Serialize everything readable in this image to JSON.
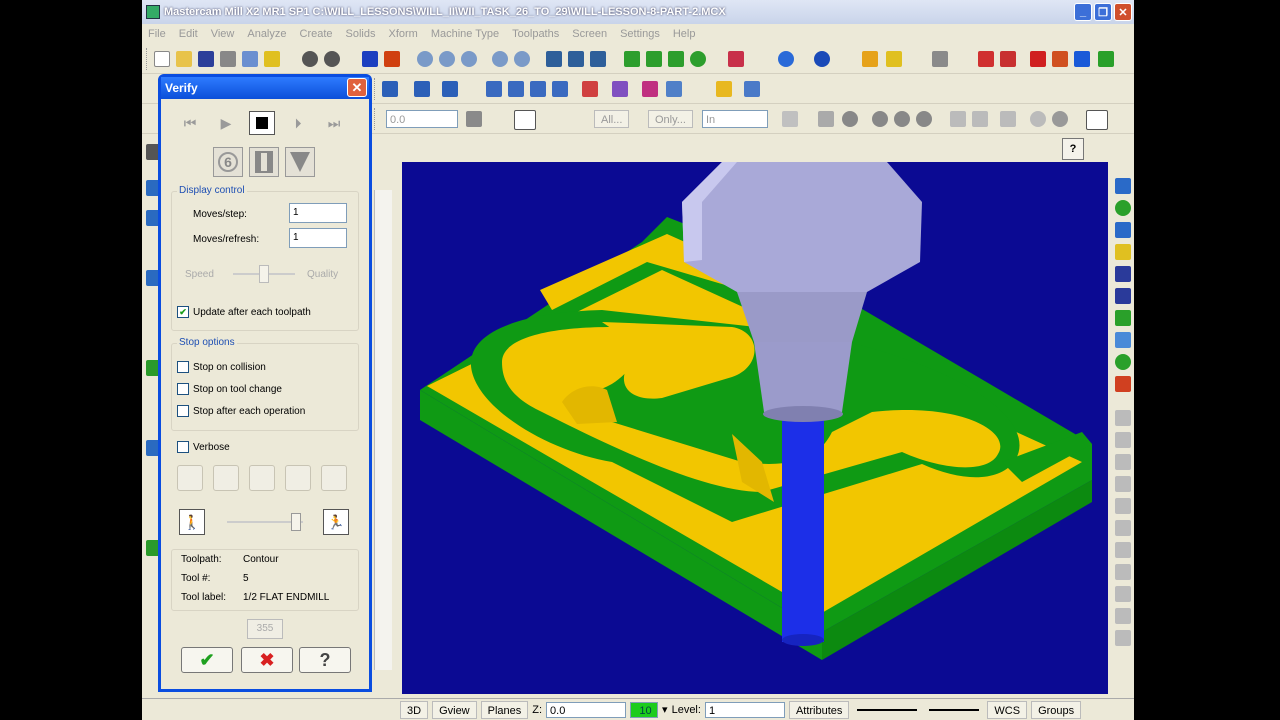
{
  "window": {
    "title": "Mastercam Mill X2 MR1 SP1  C:\\WILL_LESSONS\\WILL_II\\WII_TASK_26_TO_29\\WILL-LESSON-8-PART-2.MCX",
    "min_label": "_",
    "max_label": "❐",
    "close_label": "✕"
  },
  "menu": [
    "File",
    "Edit",
    "View",
    "Analyze",
    "Create",
    "Solids",
    "Xform",
    "Machine Type",
    "Toolpaths",
    "Screen",
    "Settings",
    "Help"
  ],
  "toolbar3": {
    "field_value": "0.0",
    "all_label": "All...",
    "only_label": "Only...",
    "in_label": "In"
  },
  "verify": {
    "title": "Verify",
    "close_label": "✕",
    "icon_mode_label": "6",
    "display_control": {
      "heading": "Display control",
      "moves_step_label": "Moves/step:",
      "moves_step_value": "1",
      "moves_refresh_label": "Moves/refresh:",
      "moves_refresh_value": "1",
      "speed_label": "Speed",
      "quality_label": "Quality",
      "update_label": "Update after each toolpath",
      "update_checked": true
    },
    "stop_options": {
      "heading": "Stop options",
      "collision_label": "Stop on collision",
      "tool_change_label": "Stop on tool change",
      "each_operation_label": "Stop after each operation"
    },
    "verbose_label": "Verbose",
    "info": {
      "toolpath_label": "Toolpath:",
      "toolpath_value": "Contour",
      "tool_num_label": "Tool #:",
      "tool_num_value": "5",
      "tool_label_label": "Tool label:",
      "tool_label_value": "1/2 FLAT ENDMILL"
    },
    "disabled_value": "355",
    "ok_symbol": "✔",
    "cancel_symbol": "✖",
    "help_symbol": "?"
  },
  "statusbar": {
    "view_3d": "3D",
    "gview": "Gview",
    "planes": "Planes",
    "z_label": "Z:",
    "z_value": "0.0",
    "color_value": "10",
    "level_label": "Level:",
    "level_value": "1",
    "attributes": "Attributes",
    "wcs": "WCS",
    "groups": "Groups"
  },
  "help_symbol": "?",
  "colors": {
    "viewport_bg": "#0b0a93",
    "stock_yellow": "#f2c600",
    "stock_green": "#0f9a14",
    "holder_gray": "#a9a9d8",
    "tool_blue": "#1c2fe8",
    "dialog_border": "#0a4de0"
  }
}
